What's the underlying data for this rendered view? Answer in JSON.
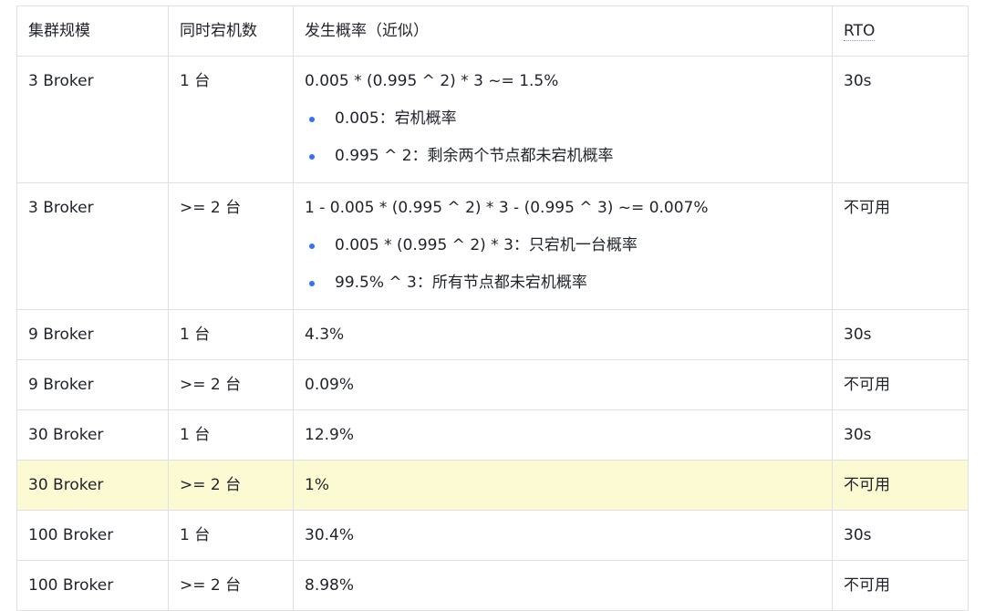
{
  "table": {
    "headers": {
      "scale": "集群规模",
      "simultaneous": "同时宕机数",
      "probability": "发生概率（近似）",
      "rto": "RTO"
    },
    "rows": [
      {
        "scale": "3 Broker",
        "simultaneous": "1 台",
        "probability": "0.005 * (0.995 ^ 2) * 3 ~= 1.5%",
        "notes": [
          "0.005：宕机概率",
          "0.995 ^ 2：剩余两个节点都未宕机概率"
        ],
        "rto": "30s"
      },
      {
        "scale": "3 Broker",
        "simultaneous": ">= 2 台",
        "probability": "1 - 0.005 * (0.995 ^ 2) * 3 - (0.995 ^ 3) ~= 0.007%",
        "notes": [
          "0.005 * (0.995 ^ 2) * 3：只宕机一台概率",
          "99.5% ^ 3：所有节点都未宕机概率"
        ],
        "rto": "不可用"
      },
      {
        "scale": "9 Broker",
        "simultaneous": "1 台",
        "probability": "4.3%",
        "rto": "30s"
      },
      {
        "scale": "9 Broker",
        "simultaneous": ">= 2 台",
        "probability": "0.09%",
        "rto": "不可用"
      },
      {
        "scale": "30 Broker",
        "simultaneous": "1 台",
        "probability": "12.9%",
        "rto": "30s"
      },
      {
        "scale": "30 Broker",
        "simultaneous": ">= 2 台",
        "probability": "1%",
        "rto": "不可用",
        "highlighted": true
      },
      {
        "scale": "100 Broker",
        "simultaneous": "1 台",
        "probability": "30.4%",
        "rto": "30s"
      },
      {
        "scale": "100 Broker",
        "simultaneous": ">= 2 台",
        "probability": "8.98%",
        "rto": "不可用"
      }
    ]
  },
  "colors": {
    "border": "#dee0e3",
    "highlight_row": "#fbfad3",
    "bullet": "#3370ff",
    "text": "#1f2329"
  }
}
